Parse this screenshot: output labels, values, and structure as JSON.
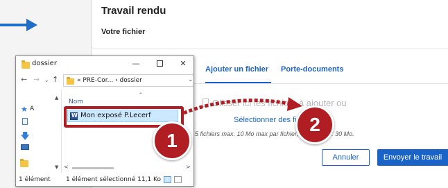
{
  "page": {
    "title": "Travail rendu",
    "subtitle": "Votre fichier",
    "tabs": [
      {
        "label": "Ajouter un fichier",
        "active": true
      },
      {
        "label": "Porte-documents",
        "active": false
      }
    ],
    "drop_text": "Glisser ici les fichiers à ajouter ou",
    "select_files": "Sélectionner des fichiers",
    "limits_text": "5 fichiers max. 10 Mo max par fichier, taille totale : 30 Mo.",
    "cancel_label": "Annuler",
    "send_label": "Envoyer le travail",
    "accent_color": "#1a63c7"
  },
  "explorer": {
    "title": "dossier",
    "window_controls": {
      "minimize": "—",
      "maximize": "☐",
      "close": "✕"
    },
    "address": "« PRE-Cor... › dossier",
    "column_header": "Nom",
    "quick_access_letter": "A",
    "files": [
      {
        "name": "Mon exposé P.Lecerf",
        "icon": "word-document-icon",
        "selected": true
      }
    ],
    "status_count": "1 élément",
    "status_selection": "1 élément sélectionné  11,1 Ko"
  },
  "annotations": {
    "step1": "1",
    "step2": "2",
    "color": "#b01e23"
  }
}
